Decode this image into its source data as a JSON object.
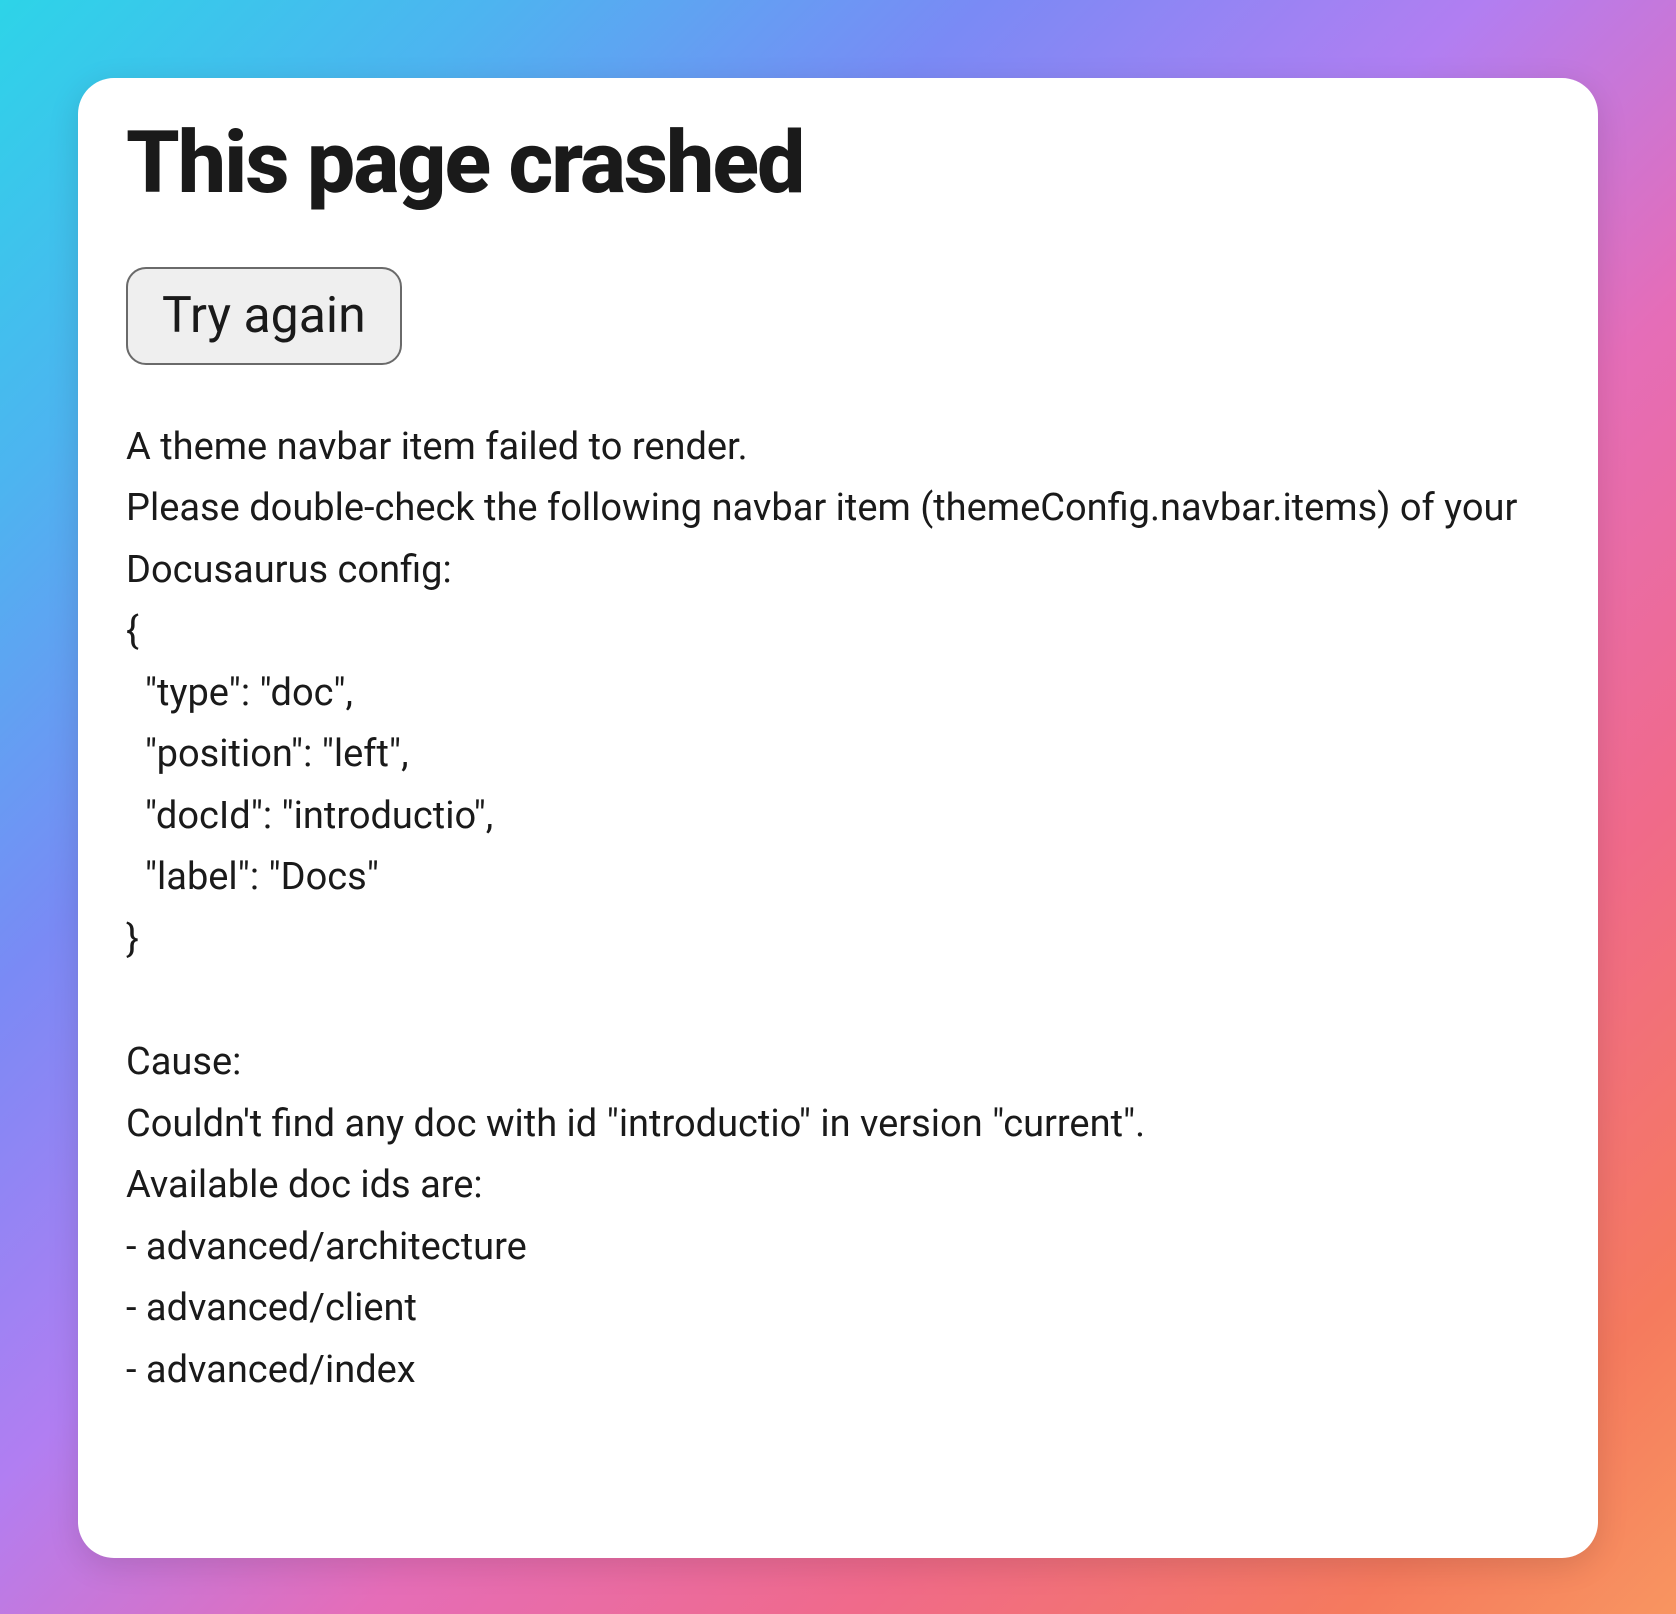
{
  "error": {
    "title": "This page crashed",
    "retry_label": "Try again",
    "message": "A theme navbar item failed to render.\nPlease double-check the following navbar item (themeConfig.navbar.items) of your Docusaurus config:\n{\n  \"type\": \"doc\",\n  \"position\": \"left\",\n  \"docId\": \"introductio\",\n  \"label\": \"Docs\"\n}\n\nCause:\nCouldn't find any doc with id \"introductio\" in version \"current\".\nAvailable doc ids are:\n- advanced/architecture\n- advanced/client\n- advanced/index"
  }
}
